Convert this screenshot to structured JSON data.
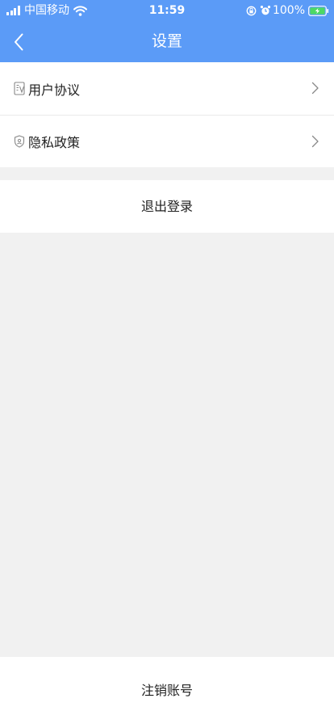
{
  "status_bar": {
    "carrier": "中国移动",
    "time": "11:59",
    "battery_percent": "100%",
    "icons": [
      "signal-icon",
      "wifi-icon",
      "orientation-lock-icon",
      "alarm-icon",
      "battery-charging-icon"
    ],
    "battery_color": "#4cd964"
  },
  "nav": {
    "title": "设置",
    "back_icon": "chevron-left-icon",
    "background_color": "#5b9bf7"
  },
  "menu": {
    "items": [
      {
        "label": "用户协议",
        "icon": "user-agreement-icon"
      },
      {
        "label": "隐私政策",
        "icon": "privacy-shield-icon"
      }
    ],
    "arrow_icon": "chevron-right-icon"
  },
  "actions": {
    "logout_label": "退出登录",
    "delete_account_label": "注销账号"
  }
}
